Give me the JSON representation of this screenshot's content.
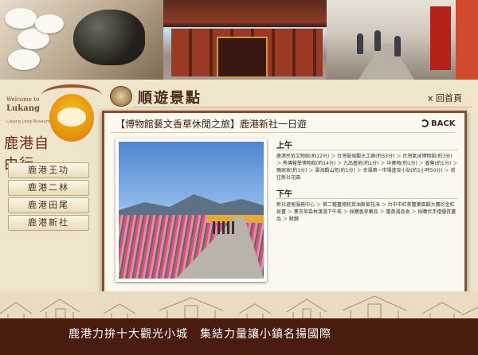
{
  "page": {
    "title": "順遊景點",
    "home_link": "x 回首頁"
  },
  "logo": {
    "welcome": "Welcome to",
    "lukang": "Lukang",
    "tagline": "Lukang Long Museum",
    "calligraphy": "鹿港自由行"
  },
  "sidebar": {
    "items": [
      {
        "label": "鹿港王功"
      },
      {
        "label": "鹿港二林"
      },
      {
        "label": "鹿港田尾"
      },
      {
        "label": "鹿港新社"
      }
    ]
  },
  "tour": {
    "title": "【博物館藝文香草休閒之旅】鹿港新社一日遊",
    "back_label": "BACK",
    "morning": {
      "label": "上午",
      "text": "鹿港民俗文物館(約22分) ＞ 台灣玻璃觀光工廠(約53分) ＞ 台灣氣球博物館(約3分) ＞ 秀傳醫學博物館(約14分) ＞ 九品藝術(約1分) ＞ 中寶梅(約1分) ＞ 香蕉(約1分) ＞ 鴨家家(約1分) ＞ 雲海觀山苑(約1分) ＞ 幸福第一市場進攻小站(約1小時50分) ＞ 前往新社花園"
    },
    "afternoon": {
      "label": "下午",
      "text": "新社遊客服務中心 ＞ 第二種薑總統賞油斯菊花海 ＞ 台中市紅茶薑葉區觀大農的金紅斑薑 ＞ 薰衣草森林漢漫下午茶 ＞ 採購香草藥品 ＞ 薑蔬湯品食 ＞ 採購伴手禮優質薑品 ＞ 賦歸"
    }
  },
  "footer": {
    "slogan": "鹿港力拚十大觀光小城　集結力量讓小鎮名揚國際"
  },
  "colors": {
    "brown_dark": "#4a1c10",
    "panel_border": "#8a4d2d",
    "cream": "#fbf8ef"
  }
}
